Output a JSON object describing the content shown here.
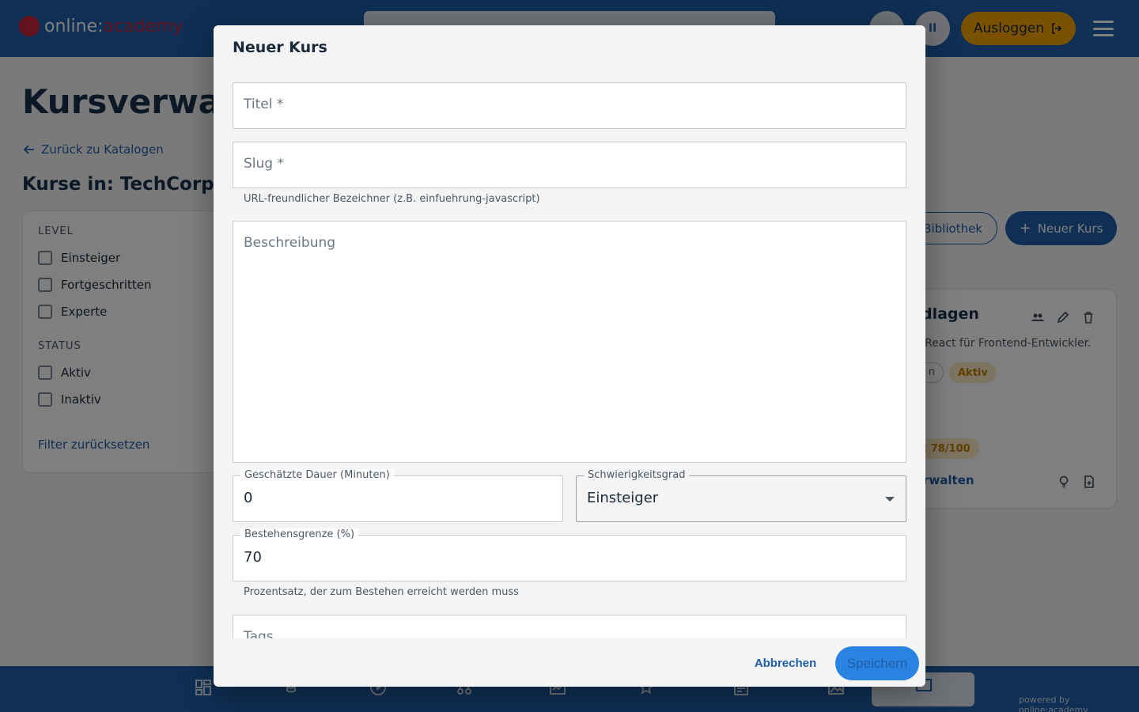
{
  "header": {
    "logo_part1": "online:",
    "logo_part2": "academy",
    "user_initials": "II",
    "logout_label": "Ausloggen"
  },
  "page": {
    "title": "Kursverwaltu",
    "back_link": "Zurück zu Katalogen",
    "section_title": "Kurse in: TechCorp IT-"
  },
  "filters": {
    "level_heading": "LEVEL",
    "levels": [
      "Einsteiger",
      "Fortgeschritten",
      "Experte"
    ],
    "status_heading": "STATUS",
    "statuses": [
      "Aktiv",
      "Inaktiv"
    ],
    "reset_label": "Filter zurücksetzen"
  },
  "actions": {
    "library_label": "Bibliothek",
    "new_course_label": "Neuer Kurs"
  },
  "course_card": {
    "title": "dlagen",
    "description": "React für Frontend-Entwickler.",
    "tag_partial": "n",
    "status_badge": "Aktiv",
    "score_badge": ": 78/100",
    "manage_link": "rwalten"
  },
  "footer": {
    "powered_by": "powered by online:academy"
  },
  "modal": {
    "title": "Neuer Kurs",
    "title_field": {
      "label": "Titel *"
    },
    "slug_field": {
      "label": "Slug *",
      "helper": "URL-freundlicher Bezeichner (z.B. einfuehrung-javascript)"
    },
    "description_field": {
      "label": "Beschreibung"
    },
    "duration_field": {
      "label": "Geschätzte Dauer (Minuten)",
      "value": "0"
    },
    "difficulty_field": {
      "label": "Schwierigkeitsgrad",
      "value": "Einsteiger"
    },
    "pass_field": {
      "label": "Bestehensgrenze (%)",
      "value": "70",
      "helper": "Prozentsatz, der zum Bestehen erreicht werden muss"
    },
    "tags_field": {
      "label": "Tags"
    },
    "cancel_label": "Abbrechen",
    "save_label": "Speichern"
  }
}
